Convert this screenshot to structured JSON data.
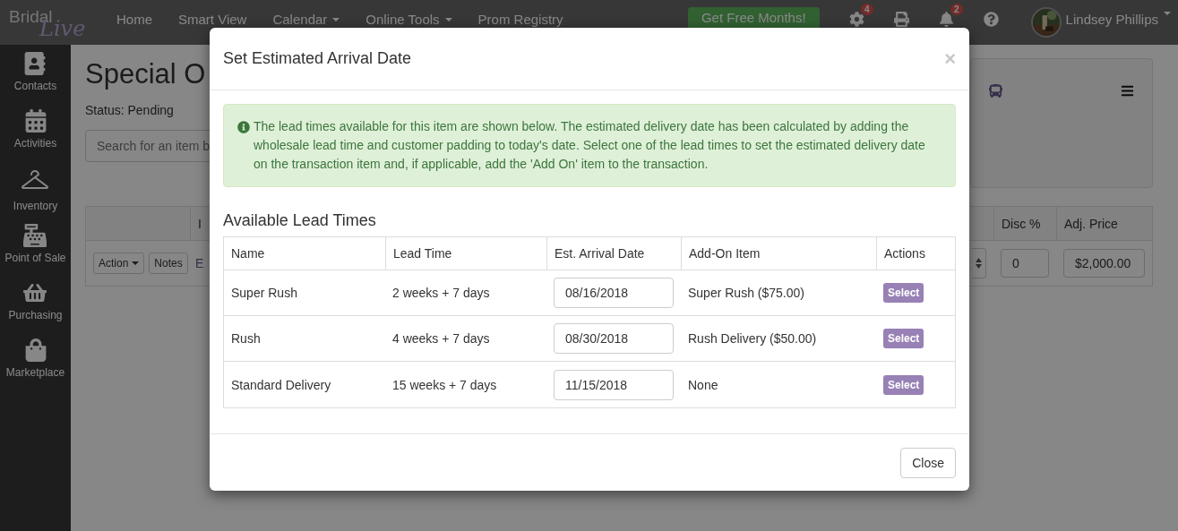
{
  "navbar": {
    "logo": {
      "text": "Bridal",
      "script": "Live"
    },
    "links": [
      {
        "label": "Home",
        "dropdown": false
      },
      {
        "label": "Smart View",
        "dropdown": false
      },
      {
        "label": "Calendar",
        "dropdown": true
      },
      {
        "label": "Online Tools",
        "dropdown": true
      },
      {
        "label": "Prom Registry",
        "dropdown": false
      }
    ],
    "promo_button": "Get Free Months!",
    "icons": [
      {
        "kind": "settings",
        "badge": "4"
      },
      {
        "kind": "print"
      },
      {
        "kind": "notifications",
        "badge": "2"
      },
      {
        "kind": "help"
      }
    ],
    "user": {
      "name": "Lindsey Phillips"
    }
  },
  "sidebar": {
    "items": [
      {
        "label": "Contacts",
        "kind": "contacts"
      },
      {
        "label": "Activities",
        "kind": "calendar"
      },
      {
        "label": "Inventory",
        "kind": "hanger"
      },
      {
        "label": "Point of Sale",
        "kind": "register"
      },
      {
        "label": "Purchasing",
        "kind": "basket"
      },
      {
        "label": "Marketplace",
        "kind": "bag"
      }
    ]
  },
  "page": {
    "title": "Special O",
    "status": "Status: Pending",
    "search": {
      "placeholder": "Search for an item b"
    },
    "table": {
      "columns": [
        {
          "label": "I"
        },
        {
          "label": "Disc %"
        },
        {
          "label": "Adj. Price"
        }
      ],
      "row": {
        "action_button": "Action",
        "notes_button": "Notes",
        "link": "E",
        "discount": "0",
        "adj_price": "$2,000.00"
      }
    }
  },
  "modal": {
    "title": "Set Estimated Arrival Date",
    "close_symbol": "×",
    "alert": "The lead times available for this item are shown below. The estimated delivery date has been calculated by adding the wholesale lead time and customer padding to today's date. Select one of the lead times to set the estimated delivery date on the transaction item and, if applicable, add the 'Add On' item to the transaction.",
    "section_title": "Available Lead Times",
    "columns": [
      "Name",
      "Lead Time",
      "Est. Arrival Date",
      "Add-On Item",
      "Actions"
    ],
    "rows": [
      {
        "name": "Super Rush",
        "lead_time": "2 weeks + 7 days",
        "arrival_date": "08/16/2018",
        "add_on": "Super Rush ($75.00)",
        "action": "Select"
      },
      {
        "name": "Rush",
        "lead_time": "4 weeks + 7 days",
        "arrival_date": "08/30/2018",
        "add_on": "Rush Delivery ($50.00)",
        "action": "Select"
      },
      {
        "name": "Standard Delivery",
        "lead_time": "15 weeks + 7 days",
        "arrival_date": "11/15/2018",
        "add_on": "None",
        "action": "Select"
      }
    ],
    "close_button": "Close"
  }
}
